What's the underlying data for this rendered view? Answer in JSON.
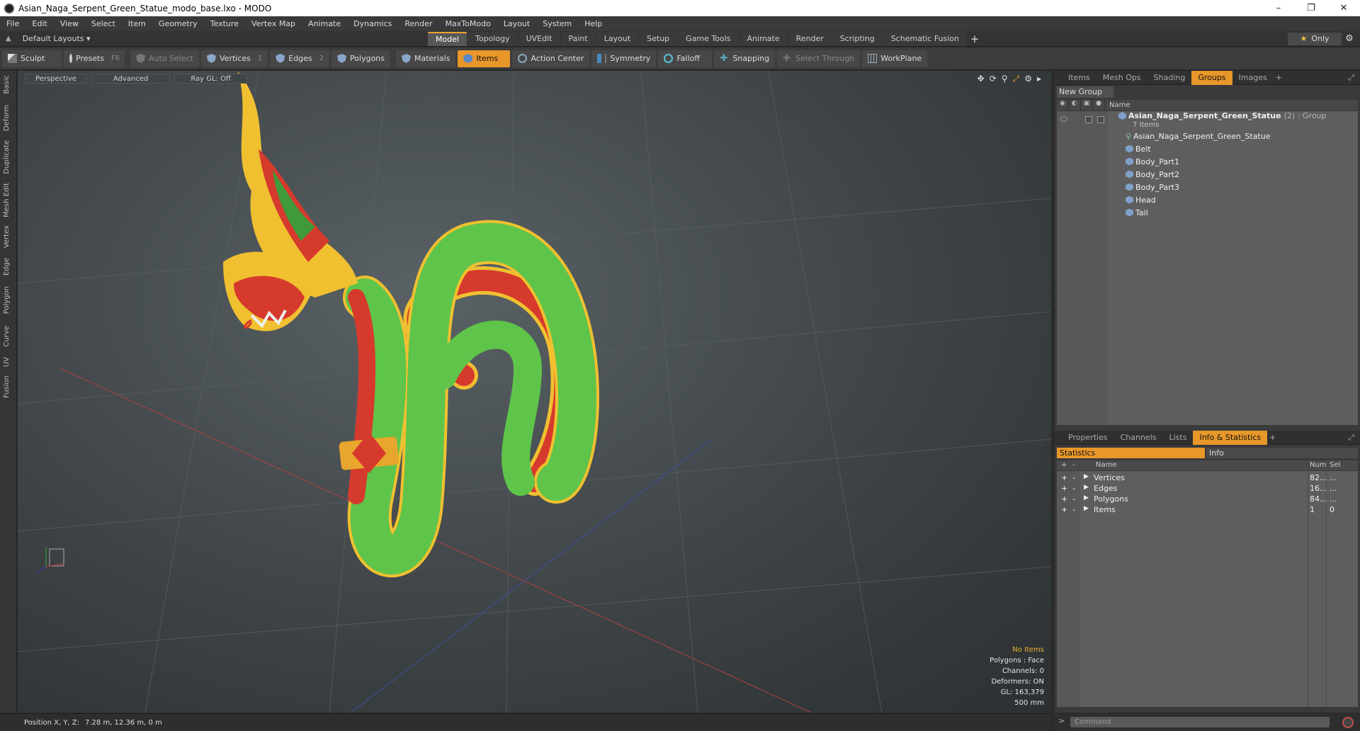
{
  "window": {
    "title": "Asian_Naga_Serpent_Green_Statue_modo_base.lxo - MODO",
    "minimize": "–",
    "maximize": "❐",
    "close": "✕"
  },
  "menu": [
    "File",
    "Edit",
    "View",
    "Select",
    "Item",
    "Geometry",
    "Texture",
    "Vertex Map",
    "Animate",
    "Dynamics",
    "Render",
    "MaxToModo",
    "Layout",
    "System",
    "Help"
  ],
  "layout_bar": {
    "layouts_label": "Default Layouts ▾",
    "tabs": [
      "Model",
      "Topology",
      "UVEdit",
      "Paint",
      "Layout",
      "Setup",
      "Game Tools",
      "Animate",
      "Render",
      "Scripting",
      "Schematic Fusion"
    ],
    "active_tab": "Model",
    "add": "+",
    "only_star": "★",
    "only_label": "Only"
  },
  "toolbar": {
    "sculpt": "Sculpt",
    "presets": "Presets",
    "presets_key": "F6",
    "auto_select": "Auto Select",
    "vertices": "Vertices",
    "vertices_key": "1",
    "edges": "Edges",
    "edges_key": "2",
    "polygons": "Polygons",
    "materials": "Materials",
    "items": "Items",
    "action_center": "Action Center",
    "symmetry": "Symmetry",
    "falloff": "Falloff",
    "snapping": "Snapping",
    "select_through": "Select Through",
    "workplane": "WorkPlane"
  },
  "left_tabs": [
    "Basic",
    "Deform",
    "Duplicate",
    "Mesh Edit",
    "Vertex",
    "Edge",
    "Polygon",
    "Curve",
    "UV",
    "Fusion"
  ],
  "viewport": {
    "view_mode": "Perspective",
    "shading": "Advanced",
    "raygl": "Ray GL: Off",
    "hud": {
      "selection": "No Items",
      "polygons": "Polygons : Face",
      "channels": "Channels: 0",
      "deformers": "Deformers: ON",
      "gl": "GL: 163,379",
      "scale": "500 mm"
    },
    "colors": {
      "body_green": "#5fc44a",
      "belly_red": "#d63a2c",
      "crest_gold": "#f0c030"
    }
  },
  "groups_panel": {
    "tabs": [
      "Items",
      "Mesh Ops",
      "Shading",
      "Groups",
      "Images"
    ],
    "active_tab": "Groups",
    "new_group": "New Group",
    "name_header": "Name",
    "group": {
      "name": "Asian_Naga_Serpent_Green_Statue",
      "type": "(2) : Group",
      "count": "7 Items"
    },
    "items": [
      "Asian_Naga_Serpent_Green_Statue",
      "Belt",
      "Body_Part1",
      "Body_Part2",
      "Body_Part3",
      "Head",
      "Tail"
    ]
  },
  "stats_panel": {
    "tabs": [
      "Properties",
      "Channels",
      "Lists",
      "Info & Statistics"
    ],
    "active_tab": "Info & Statistics",
    "sub_tabs": [
      "Statistics",
      "Info"
    ],
    "headers": {
      "name": "Name",
      "num": "Num",
      "sel": "Sel"
    },
    "rows": [
      {
        "name": "Vertices",
        "num": "82...",
        "sel": "..."
      },
      {
        "name": "Edges",
        "num": "16...",
        "sel": "..."
      },
      {
        "name": "Polygons",
        "num": "84...",
        "sel": "..."
      },
      {
        "name": "Items",
        "num": "1",
        "sel": "0"
      }
    ]
  },
  "status": {
    "position_label": "Position X, Y, Z:",
    "position_value": "7.28 m, 12.36 m, 0 m"
  },
  "command": {
    "placeholder": "Command"
  }
}
